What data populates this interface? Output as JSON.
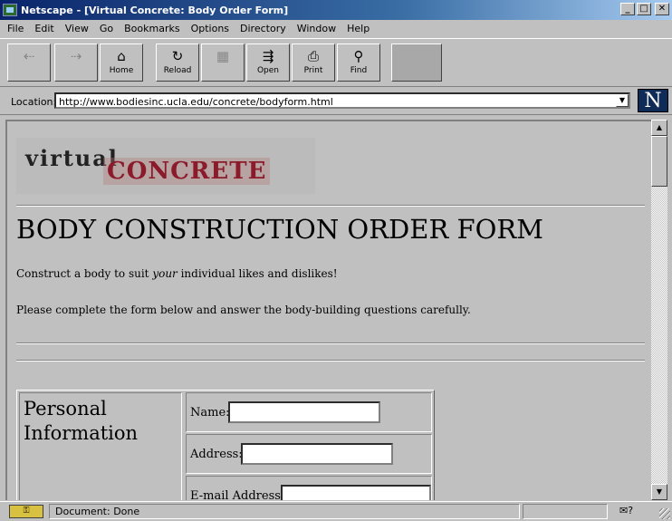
{
  "window": {
    "title": "Netscape - [Virtual Concrete: Body Order Form]"
  },
  "menubar": {
    "items": [
      "File",
      "Edit",
      "View",
      "Go",
      "Bookmarks",
      "Options",
      "Directory",
      "Window",
      "Help"
    ]
  },
  "toolbar": {
    "buttons": [
      {
        "label": "",
        "icon": "back-arrow-icon"
      },
      {
        "label": "",
        "icon": "forward-arrow-icon"
      },
      {
        "label": "Home",
        "icon": "home-icon"
      },
      {
        "label": "Reload",
        "icon": "reload-icon"
      },
      {
        "label": "",
        "icon": "images-icon"
      },
      {
        "label": "Open",
        "icon": "open-icon"
      },
      {
        "label": "Print",
        "icon": "print-icon"
      },
      {
        "label": "Find",
        "icon": "find-icon"
      },
      {
        "label": "",
        "icon": "stop-icon"
      }
    ]
  },
  "location": {
    "label": "Location:",
    "url": "http://www.bodiesinc.ucla.edu/concrete/bodyform.html"
  },
  "page": {
    "banner_word1": "virtual",
    "banner_word2": "CONCRETE",
    "heading": "BODY CONSTRUCTION ORDER FORM",
    "intro_pre": "Construct a body to suit ",
    "intro_em": "your",
    "intro_post": " individual likes and dislikes!",
    "instructions": "Please complete the form below and answer the body-building questions carefully.",
    "section_title": "Personal Information",
    "fields": [
      {
        "label": "Name:",
        "value": ""
      },
      {
        "label": "Address:",
        "value": ""
      },
      {
        "label": "E-mail Address:",
        "value": ""
      }
    ]
  },
  "status": {
    "text": "Document: Done"
  }
}
